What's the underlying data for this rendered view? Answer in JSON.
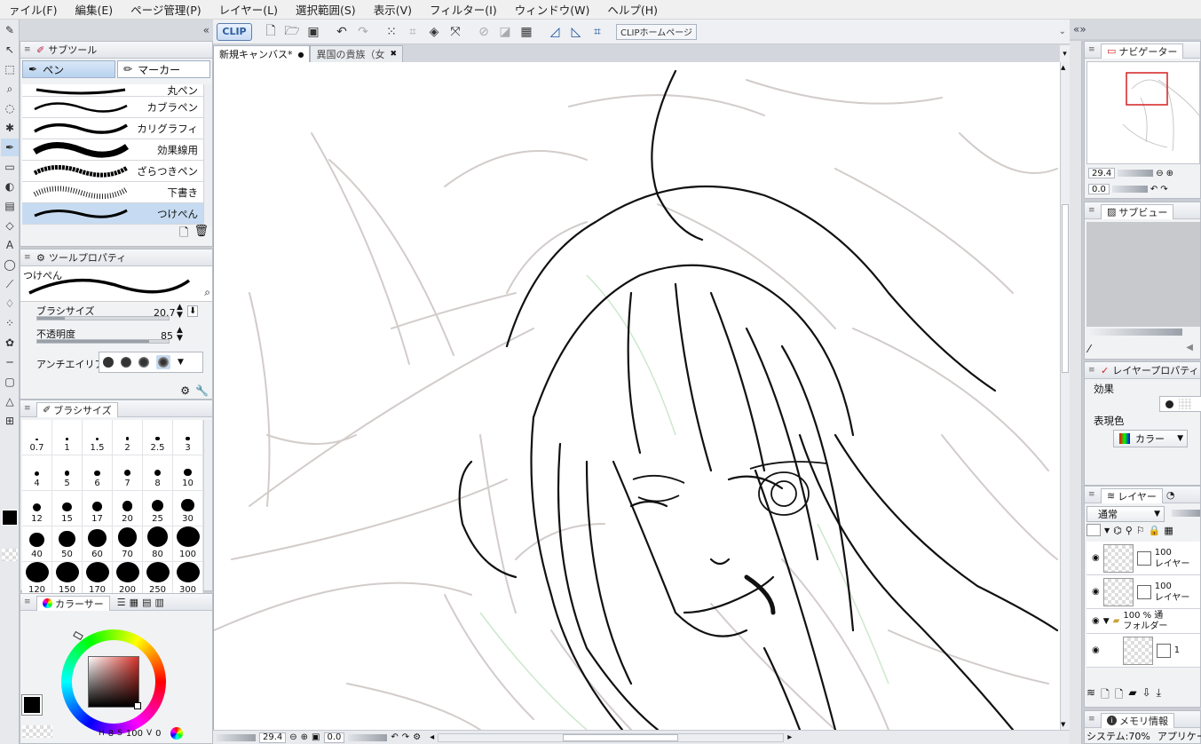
{
  "menu": [
    "ァイル(F)",
    "編集(E)",
    "ページ管理(P)",
    "レイヤー(L)",
    "選択範囲(S)",
    "表示(V)",
    "フィルター(I)",
    "ウィンドウ(W)",
    "ヘルプ(H)"
  ],
  "command_bar": {
    "logo": "CLIP",
    "home_button": "CLIPホームページ"
  },
  "doc_tabs": [
    {
      "label": "新規キャンバス*",
      "close": "●"
    },
    {
      "label": "異国の貴族（女",
      "close": "✖"
    }
  ],
  "subtool": {
    "title": "サブツール",
    "tabs": [
      "ペン",
      "マーカー"
    ],
    "brushes": [
      "丸ペン",
      "カブラペン",
      "カリグラフィ",
      "効果線用",
      "ざらつきペン",
      "下書き",
      "つけぺん"
    ],
    "selected_brush": "つけぺん"
  },
  "toolprop": {
    "title": "ツールプロパティ",
    "preview_label": "つけぺん",
    "brush_size_label": "ブラシサイズ",
    "brush_size_value": "20.7",
    "brush_size_fraction": 0.21,
    "opacity_label": "不透明度",
    "opacity_value": "85",
    "opacity_fraction": 0.85,
    "antialias_label": "アンチエイリアス"
  },
  "brushsize": {
    "title": "ブラシサイズ",
    "sizes": [
      "0.7",
      "1",
      "1.5",
      "2",
      "2.5",
      "3",
      "4",
      "5",
      "6",
      "7",
      "8",
      "10",
      "12",
      "15",
      "17",
      "20",
      "25",
      "30",
      "40",
      "50",
      "60",
      "70",
      "80",
      "100",
      "120",
      "150",
      "170",
      "200",
      "250",
      "300"
    ]
  },
  "colorpanel": {
    "title": "カラーサー",
    "main_color": "#000000",
    "hue_color": "#d9322a",
    "footer": {
      "h": "8",
      "s": "100",
      "v": "0"
    }
  },
  "statusbar": {
    "zoom": "29.4",
    "angle": "0.0"
  },
  "navigator": {
    "title": "ナビゲーター",
    "zoom": "29.4",
    "angle": "0.0"
  },
  "subview": {
    "title": "サブビュー"
  },
  "layerprop": {
    "title": "レイヤープロパティ",
    "effect_label": "効果",
    "color_label": "表現色",
    "color_value": "カラー"
  },
  "layer": {
    "title": "レイヤー",
    "blend_mode": "通常",
    "rows": [
      {
        "opacity": "100",
        "name": "レイヤー"
      },
      {
        "opacity": "100",
        "name": "レイヤー"
      },
      {
        "opacity": "100 % 通",
        "name": "フォルダー"
      },
      {
        "opacity": "1",
        "name": ""
      }
    ]
  },
  "meminfo": {
    "title": "メモリ情報",
    "system": "システム:70%",
    "app": "アプリケーション"
  }
}
